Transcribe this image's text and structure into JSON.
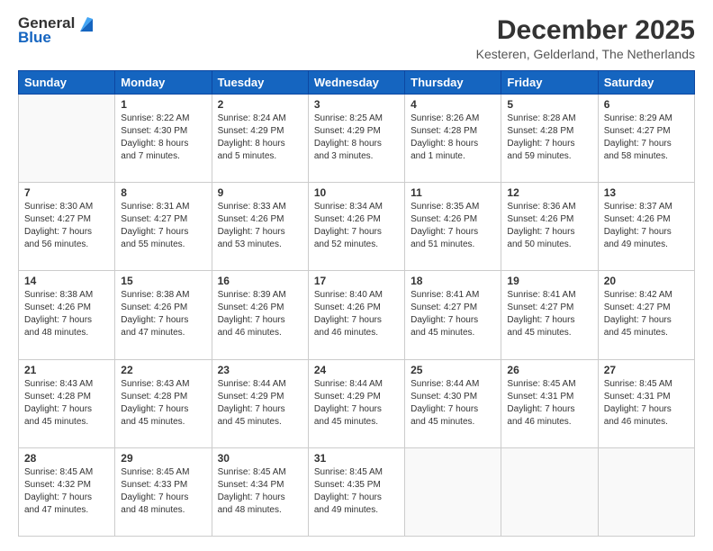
{
  "header": {
    "logo_general": "General",
    "logo_blue": "Blue",
    "title": "December 2025",
    "subtitle": "Kesteren, Gelderland, The Netherlands"
  },
  "days_of_week": [
    "Sunday",
    "Monday",
    "Tuesday",
    "Wednesday",
    "Thursday",
    "Friday",
    "Saturday"
  ],
  "weeks": [
    [
      {
        "day": "",
        "info": ""
      },
      {
        "day": "1",
        "info": "Sunrise: 8:22 AM\nSunset: 4:30 PM\nDaylight: 8 hours\nand 7 minutes."
      },
      {
        "day": "2",
        "info": "Sunrise: 8:24 AM\nSunset: 4:29 PM\nDaylight: 8 hours\nand 5 minutes."
      },
      {
        "day": "3",
        "info": "Sunrise: 8:25 AM\nSunset: 4:29 PM\nDaylight: 8 hours\nand 3 minutes."
      },
      {
        "day": "4",
        "info": "Sunrise: 8:26 AM\nSunset: 4:28 PM\nDaylight: 8 hours\nand 1 minute."
      },
      {
        "day": "5",
        "info": "Sunrise: 8:28 AM\nSunset: 4:28 PM\nDaylight: 7 hours\nand 59 minutes."
      },
      {
        "day": "6",
        "info": "Sunrise: 8:29 AM\nSunset: 4:27 PM\nDaylight: 7 hours\nand 58 minutes."
      }
    ],
    [
      {
        "day": "7",
        "info": "Sunrise: 8:30 AM\nSunset: 4:27 PM\nDaylight: 7 hours\nand 56 minutes."
      },
      {
        "day": "8",
        "info": "Sunrise: 8:31 AM\nSunset: 4:27 PM\nDaylight: 7 hours\nand 55 minutes."
      },
      {
        "day": "9",
        "info": "Sunrise: 8:33 AM\nSunset: 4:26 PM\nDaylight: 7 hours\nand 53 minutes."
      },
      {
        "day": "10",
        "info": "Sunrise: 8:34 AM\nSunset: 4:26 PM\nDaylight: 7 hours\nand 52 minutes."
      },
      {
        "day": "11",
        "info": "Sunrise: 8:35 AM\nSunset: 4:26 PM\nDaylight: 7 hours\nand 51 minutes."
      },
      {
        "day": "12",
        "info": "Sunrise: 8:36 AM\nSunset: 4:26 PM\nDaylight: 7 hours\nand 50 minutes."
      },
      {
        "day": "13",
        "info": "Sunrise: 8:37 AM\nSunset: 4:26 PM\nDaylight: 7 hours\nand 49 minutes."
      }
    ],
    [
      {
        "day": "14",
        "info": "Sunrise: 8:38 AM\nSunset: 4:26 PM\nDaylight: 7 hours\nand 48 minutes."
      },
      {
        "day": "15",
        "info": "Sunrise: 8:38 AM\nSunset: 4:26 PM\nDaylight: 7 hours\nand 47 minutes."
      },
      {
        "day": "16",
        "info": "Sunrise: 8:39 AM\nSunset: 4:26 PM\nDaylight: 7 hours\nand 46 minutes."
      },
      {
        "day": "17",
        "info": "Sunrise: 8:40 AM\nSunset: 4:26 PM\nDaylight: 7 hours\nand 46 minutes."
      },
      {
        "day": "18",
        "info": "Sunrise: 8:41 AM\nSunset: 4:27 PM\nDaylight: 7 hours\nand 45 minutes."
      },
      {
        "day": "19",
        "info": "Sunrise: 8:41 AM\nSunset: 4:27 PM\nDaylight: 7 hours\nand 45 minutes."
      },
      {
        "day": "20",
        "info": "Sunrise: 8:42 AM\nSunset: 4:27 PM\nDaylight: 7 hours\nand 45 minutes."
      }
    ],
    [
      {
        "day": "21",
        "info": "Sunrise: 8:43 AM\nSunset: 4:28 PM\nDaylight: 7 hours\nand 45 minutes."
      },
      {
        "day": "22",
        "info": "Sunrise: 8:43 AM\nSunset: 4:28 PM\nDaylight: 7 hours\nand 45 minutes."
      },
      {
        "day": "23",
        "info": "Sunrise: 8:44 AM\nSunset: 4:29 PM\nDaylight: 7 hours\nand 45 minutes."
      },
      {
        "day": "24",
        "info": "Sunrise: 8:44 AM\nSunset: 4:29 PM\nDaylight: 7 hours\nand 45 minutes."
      },
      {
        "day": "25",
        "info": "Sunrise: 8:44 AM\nSunset: 4:30 PM\nDaylight: 7 hours\nand 45 minutes."
      },
      {
        "day": "26",
        "info": "Sunrise: 8:45 AM\nSunset: 4:31 PM\nDaylight: 7 hours\nand 46 minutes."
      },
      {
        "day": "27",
        "info": "Sunrise: 8:45 AM\nSunset: 4:31 PM\nDaylight: 7 hours\nand 46 minutes."
      }
    ],
    [
      {
        "day": "28",
        "info": "Sunrise: 8:45 AM\nSunset: 4:32 PM\nDaylight: 7 hours\nand 47 minutes."
      },
      {
        "day": "29",
        "info": "Sunrise: 8:45 AM\nSunset: 4:33 PM\nDaylight: 7 hours\nand 48 minutes."
      },
      {
        "day": "30",
        "info": "Sunrise: 8:45 AM\nSunset: 4:34 PM\nDaylight: 7 hours\nand 48 minutes."
      },
      {
        "day": "31",
        "info": "Sunrise: 8:45 AM\nSunset: 4:35 PM\nDaylight: 7 hours\nand 49 minutes."
      },
      {
        "day": "",
        "info": ""
      },
      {
        "day": "",
        "info": ""
      },
      {
        "day": "",
        "info": ""
      }
    ]
  ]
}
